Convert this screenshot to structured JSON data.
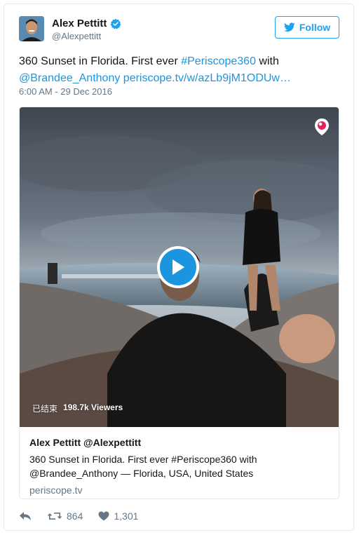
{
  "author": {
    "name": "Alex Pettitt",
    "handle": "@Alexpettitt",
    "verified": true,
    "avatar_icon": "avatar-icon"
  },
  "follow_button": {
    "label": "Follow",
    "icon": "bird-icon"
  },
  "tweet": {
    "text_parts": [
      {
        "text": "360 Sunset in Florida. First ever ",
        "type": "plain"
      },
      {
        "text": "#Periscope360",
        "type": "link"
      },
      {
        "text": " with ",
        "type": "plain"
      },
      {
        "text": "@Brandee_Anthony",
        "type": "link"
      },
      {
        "text": " periscope.tv/w/azLb9jM1ODUw…",
        "type": "link"
      }
    ],
    "timestamp": "6:00 AM - 29 Dec 2016"
  },
  "media": {
    "status_label": "已结束",
    "viewers": "198.7k Viewers",
    "play_icon": "play-icon",
    "brand_icon": "periscope-icon"
  },
  "card": {
    "title": "Alex Pettitt @Alexpettitt",
    "description_line1": "360 Sunset in Florida. First ever #Periscope360 with",
    "description_line2": "@Brandee_Anthony — Florida, USA, United States",
    "domain": "periscope.tv"
  },
  "actions": {
    "reply_icon": "reply-icon",
    "retweet_count": "864",
    "like_count": "1,301"
  },
  "colors": {
    "link": "#1b95e0",
    "muted": "#657786",
    "accent": "#1da1f2",
    "periscope_red": "#e0245e"
  }
}
